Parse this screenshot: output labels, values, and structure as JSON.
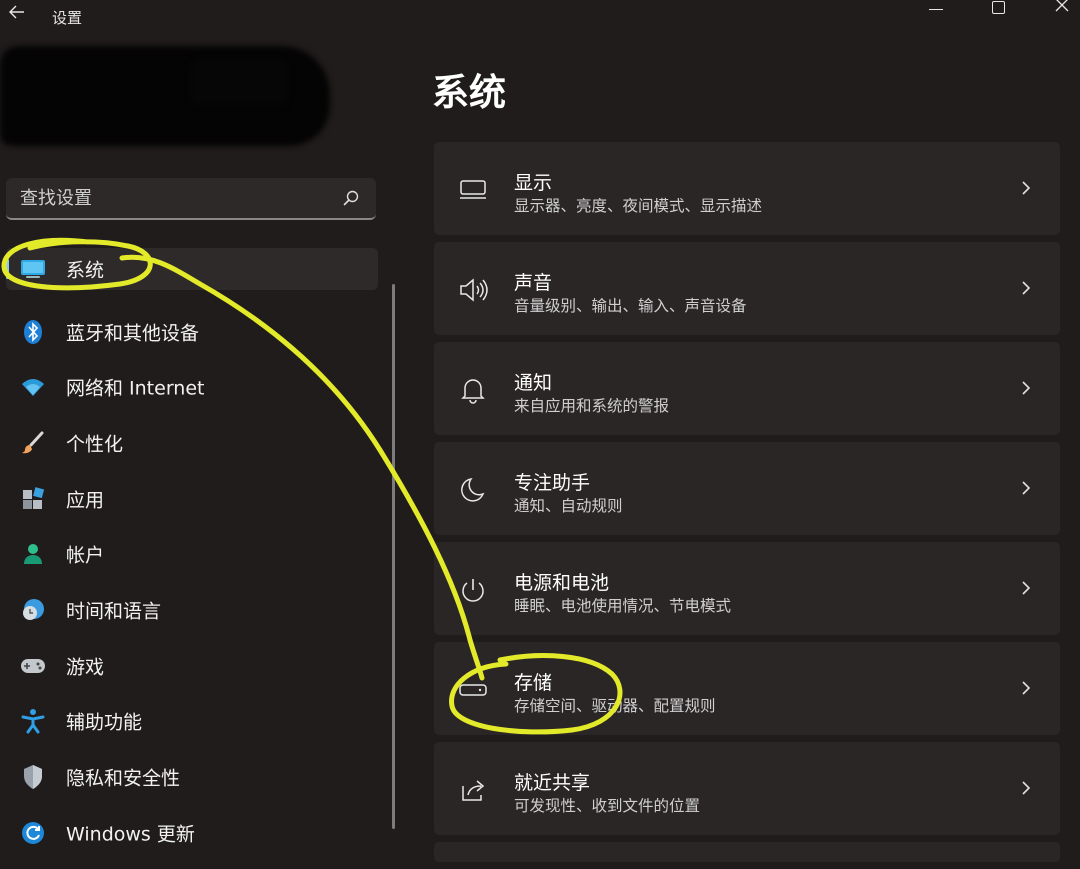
{
  "window": {
    "title": "设置",
    "back_icon": "back-arrow-icon",
    "minimize_icon": "minimize-icon",
    "maximize_icon": "maximize-icon",
    "close_icon": "close-icon"
  },
  "search": {
    "placeholder": "查找设置",
    "icon": "search-icon"
  },
  "sidebar": {
    "items": [
      {
        "label": "系统",
        "icon": "system-display-icon",
        "active": true
      },
      {
        "label": "蓝牙和其他设备",
        "icon": "bluetooth-icon"
      },
      {
        "label": "网络和 Internet",
        "icon": "wifi-icon"
      },
      {
        "label": "个性化",
        "icon": "brush-icon"
      },
      {
        "label": "应用",
        "icon": "apps-icon"
      },
      {
        "label": "帐户",
        "icon": "account-icon"
      },
      {
        "label": "时间和语言",
        "icon": "time-language-icon"
      },
      {
        "label": "游戏",
        "icon": "gamepad-icon"
      },
      {
        "label": "辅助功能",
        "icon": "accessibility-icon"
      },
      {
        "label": "隐私和安全性",
        "icon": "shield-icon"
      },
      {
        "label": "Windows 更新",
        "icon": "windows-update-icon"
      }
    ]
  },
  "main": {
    "title": "系统",
    "cards": [
      {
        "title": "显示",
        "subtitle": "显示器、亮度、夜间模式、显示描述",
        "icon": "monitor-icon"
      },
      {
        "title": "声音",
        "subtitle": "音量级别、输出、输入、声音设备",
        "icon": "speaker-icon"
      },
      {
        "title": "通知",
        "subtitle": "来自应用和系统的警报",
        "icon": "bell-icon"
      },
      {
        "title": "专注助手",
        "subtitle": "通知、自动规则",
        "icon": "moon-icon"
      },
      {
        "title": "电源和电池",
        "subtitle": "睡眠、电池使用情况、节电模式",
        "icon": "power-icon"
      },
      {
        "title": "存储",
        "subtitle": "存储空间、驱动器、配置规则",
        "icon": "storage-drive-icon"
      },
      {
        "title": "就近共享",
        "subtitle": "可发现性、收到文件的位置",
        "icon": "share-icon"
      }
    ]
  },
  "colors": {
    "background": "#201c1c",
    "card": "#2a2626",
    "accent": "#8ecbf0",
    "annotation": "#e3ea2a"
  }
}
